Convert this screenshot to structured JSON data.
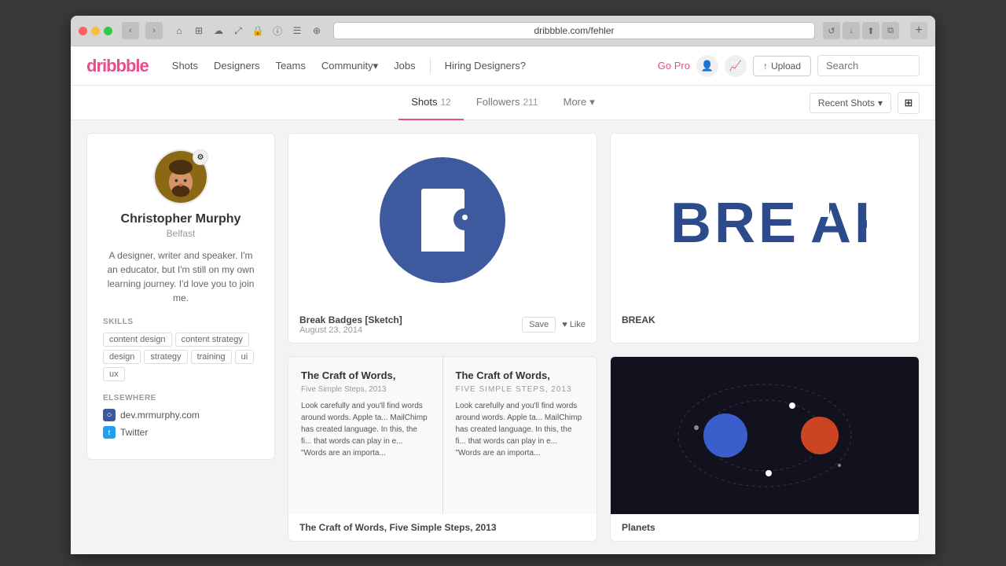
{
  "browser": {
    "url": "dribbble.com/fehler",
    "tab": "dribbble.com/fehler",
    "add_tab": "+"
  },
  "nav": {
    "logo": "dribbble",
    "links": [
      {
        "label": "Shots",
        "id": "shots"
      },
      {
        "label": "Designers",
        "id": "designers"
      },
      {
        "label": "Teams",
        "id": "teams"
      },
      {
        "label": "Community",
        "id": "community",
        "hasDropdown": true
      },
      {
        "label": "Jobs",
        "id": "jobs"
      }
    ],
    "divider_label": "|",
    "hiring": "Hiring Designers?",
    "go_pro": "Go Pro",
    "upload": "Upload",
    "search_placeholder": "Search"
  },
  "profile_subnav": {
    "tabs": [
      {
        "label": "Shots",
        "count": "12",
        "active": true
      },
      {
        "label": "Followers",
        "count": "211",
        "active": false
      },
      {
        "label": "More",
        "hasDropdown": true,
        "active": false
      }
    ],
    "view_button": "Recent Shots",
    "grid_icon": "grid"
  },
  "profile": {
    "name": "Christopher Murphy",
    "location": "Belfast",
    "bio": "A designer, writer and speaker. I'm an educator, but I'm still on my own learning journey. I'd love you to join me.",
    "skills_label": "SKILLS",
    "skills": [
      "content design",
      "content strategy",
      "design",
      "strategy",
      "training",
      "ui",
      "ux"
    ],
    "elsewhere_label": "ELSEWHERE",
    "links": [
      {
        "label": "dev.mrmurphy.com",
        "type": "globe"
      },
      {
        "label": "Twitter",
        "type": "twitter"
      }
    ],
    "gear_icon": "⚙"
  },
  "shots": [
    {
      "id": "shot-1",
      "title": "Break Badges [Sketch]",
      "date": "August 23, 2014",
      "save_label": "Save",
      "like_label": "Like",
      "type": "break-badge"
    },
    {
      "id": "shot-2",
      "title": "BREAK",
      "date": "",
      "save_label": "",
      "like_label": "",
      "type": "break-text"
    },
    {
      "id": "shot-3",
      "title": "The Craft of Words, Five Simple Steps, 2013",
      "date": "",
      "save_label": "",
      "like_label": "",
      "type": "craft-words"
    },
    {
      "id": "shot-4",
      "title": "Planets",
      "date": "",
      "save_label": "",
      "like_label": "",
      "type": "planets"
    }
  ],
  "icons": {
    "chevron_down": "▾",
    "grid": "⊞",
    "upload_arrow": "↑",
    "heart": "♥",
    "globe": "○",
    "twitter_bird": "🐦"
  }
}
